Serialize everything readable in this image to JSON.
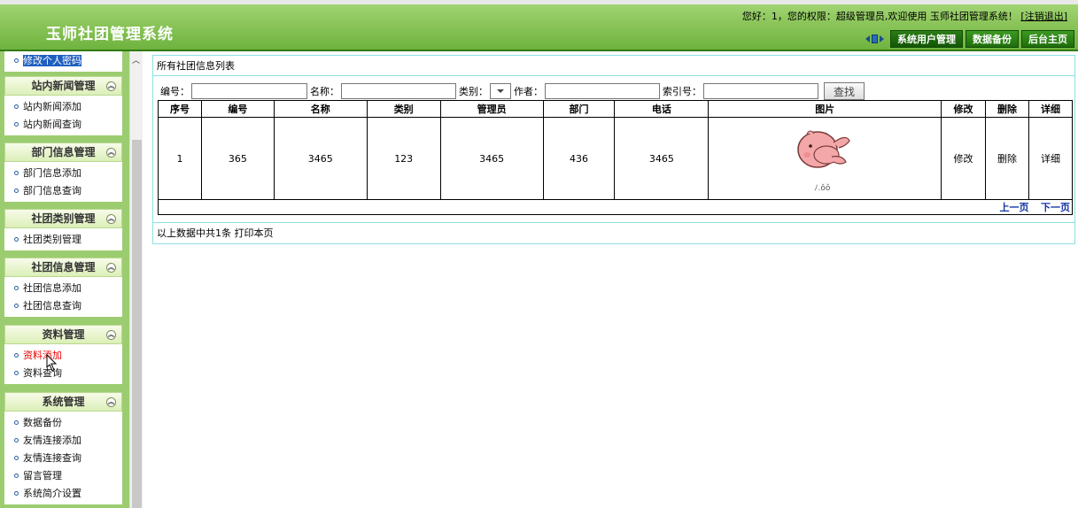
{
  "header": {
    "app_title": "玉师社团管理系统",
    "welcome_text": "您好：1，您的权限：超级管理员,欢迎使用  玉师社团管理系统！",
    "logout_label": "[注销退出]",
    "nav_buttons": [
      "系统用户管理",
      "数据备份",
      "后台主页"
    ]
  },
  "sidebar": {
    "top_item": "修改个人密码",
    "sections": [
      {
        "title": "站内新闻管理",
        "items": [
          "站内新闻添加",
          "站内新闻查询"
        ]
      },
      {
        "title": "部门信息管理",
        "items": [
          "部门信息添加",
          "部门信息查询"
        ]
      },
      {
        "title": "社团类别管理",
        "items": [
          "社团类别管理"
        ]
      },
      {
        "title": "社团信息管理",
        "items": [
          "社团信息添加",
          "社团信息查询"
        ]
      },
      {
        "title": "资料管理",
        "items": [
          "资料添加",
          "资料查询"
        ]
      },
      {
        "title": "系统管理",
        "items": [
          "数据备份",
          "友情连接添加",
          "友情连接查询",
          "留言管理",
          "系统简介设置"
        ]
      }
    ]
  },
  "main": {
    "list_title": "所有社团信息列表",
    "search": {
      "id_label": "编号：",
      "name_label": "名称：",
      "type_label": "类别：",
      "author_label": "作者：",
      "index_label": "索引号：",
      "search_button": "查找"
    },
    "table": {
      "headers": [
        "序号",
        "编号",
        "名称",
        "类别",
        "管理员",
        "部门",
        "电话",
        "图片",
        "修改",
        "删除",
        "详细"
      ],
      "rows": [
        {
          "seq": "1",
          "id": "365",
          "name": "3465",
          "type": "123",
          "admin": "3465",
          "dept": "436",
          "phone": "3465",
          "edit": "修改",
          "delete": "删除",
          "detail": "详细"
        }
      ],
      "prev_page": "上一页",
      "next_page": "下一页"
    },
    "footer_text": "以上数据中共1条",
    "print_label": "打印本页"
  },
  "colors": {
    "header_green": "#8cc65b",
    "sidebar_green": "#9ccc70",
    "link_blue": "#1233a4"
  }
}
